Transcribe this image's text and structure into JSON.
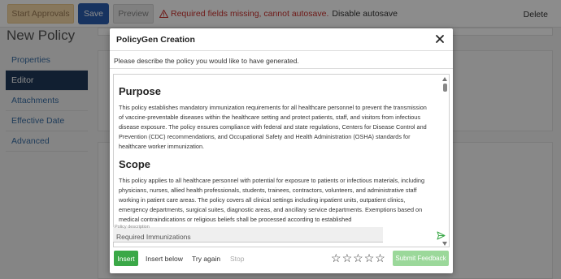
{
  "toolbar": {
    "start_approvals_label": "Start Approvals",
    "save_label": "Save",
    "preview_label": "Preview",
    "warning_text": "Required fields missing, cannot autosave.",
    "disable_autosave_label": "Disable autosave",
    "delete_label": "Delete"
  },
  "page": {
    "title": "New Policy"
  },
  "sidebar": {
    "items": [
      {
        "label": "Properties"
      },
      {
        "label": "Editor"
      },
      {
        "label": "Attachments"
      },
      {
        "label": "Effective Date"
      },
      {
        "label": "Advanced"
      }
    ],
    "active_index": 1
  },
  "modal": {
    "title": "PolicyGen Creation",
    "prompt": "Please describe the policy you would like to have generated.",
    "content": {
      "sections": [
        {
          "heading": "Purpose",
          "body": "This policy establishes mandatory immunization requirements for all healthcare personnel to prevent the transmission of vaccine-preventable diseases within the healthcare setting and protect patients, staff, and visitors from infectious disease exposure. The policy ensures compliance with federal and state regulations, Centers for Disease Control and Prevention (CDC) recommendations, and Occupational Safety and Health Administration (OSHA) standards for healthcare worker immunization."
        },
        {
          "heading": "Scope",
          "body": "This policy applies to all healthcare personnel with potential for exposure to patients or infectious materials, including physicians, nurses, allied health professionals, students, trainees, contractors, volunteers, and administrative staff working in patient care areas. The policy covers all clinical settings including inpatient units, outpatient clinics, emergency departments, surgical suites, diagnostic areas, and ancillary service departments. Exemptions based on medical contraindications or religious beliefs shall be processed according to established"
        }
      ]
    },
    "input": {
      "label": "Policy description",
      "value": "Required Immunizations"
    },
    "footer": {
      "insert_label": "Insert",
      "insert_below_label": "Insert below",
      "try_again_label": "Try again",
      "stop_label": "Stop",
      "rating": 0,
      "rating_max": 5,
      "submit_feedback_label": "Submit Feedback"
    }
  },
  "colors": {
    "save_button": "#2a5db0",
    "warning": "#c9302c",
    "insert_button": "#3aa847",
    "feedback_button": "#9bd89a",
    "active_nav": "#1f3a5a"
  }
}
